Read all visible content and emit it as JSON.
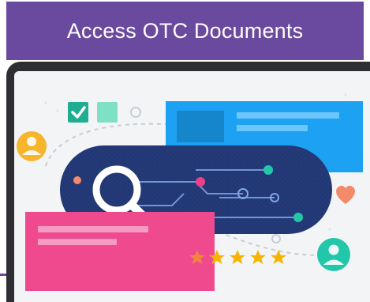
{
  "header": {
    "title": "Access OTC Documents"
  },
  "illustration": {
    "rating_stars": 5,
    "colors": {
      "banner": "#6a4a9e",
      "laptop_frame": "#2f2f33",
      "search_pill": "#243a78",
      "blue_card": "#1da1f2",
      "pink_card": "#ec3f86",
      "teal": "#21c7a8",
      "star": "#f6b400",
      "heart": "#f28a6b",
      "avatar_yellow": "#f7b52b"
    },
    "icons": [
      "checkbox-checked-icon",
      "checkbox-empty-icon",
      "user-avatar-icon",
      "magnifier-icon",
      "heart-icon",
      "star-icon"
    ]
  }
}
